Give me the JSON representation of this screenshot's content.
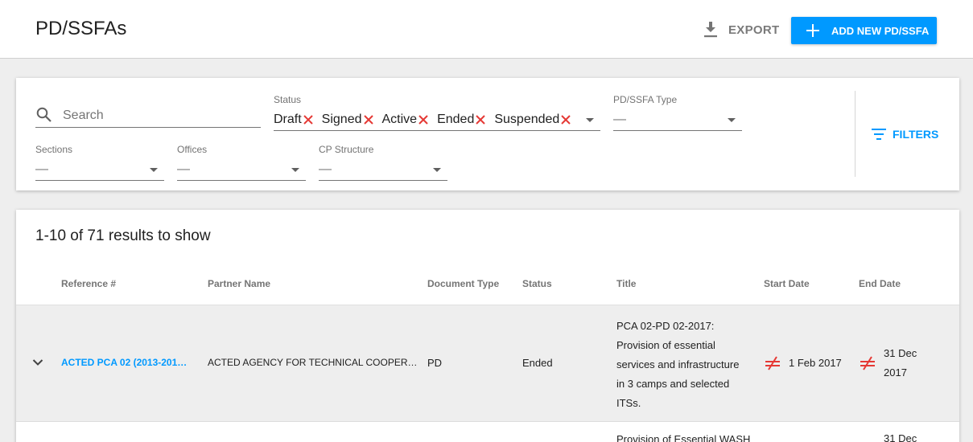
{
  "header": {
    "title": "PD/SSFAs",
    "export_label": "EXPORT",
    "add_label": "ADD NEW PD/SSFA"
  },
  "filters": {
    "search_placeholder": "Search",
    "status": {
      "label": "Status",
      "chips": [
        "Draft",
        "Signed",
        "Active",
        "Ended",
        "Suspended"
      ]
    },
    "type": {
      "label": "PD/SSFA Type",
      "value": "—"
    },
    "sections": {
      "label": "Sections",
      "value": "—"
    },
    "offices": {
      "label": "Offices",
      "value": "—"
    },
    "cp_structure": {
      "label": "CP Structure",
      "value": "—"
    },
    "filters_label": "FILTERS"
  },
  "results": {
    "count_text": "1-10 of 71 results to show",
    "columns": [
      "Reference #",
      "Partner Name",
      "Document Type",
      "Status",
      "Title",
      "Start Date",
      "End Date"
    ],
    "rows": [
      {
        "reference": "ACTED PCA 02 (2013-201…",
        "partner": "ACTED AGENCY FOR TECHNICAL COOPER…",
        "doc_type": "PD",
        "status": "Ended",
        "title_lines": [
          "PCA 02-PD 02-2017:",
          "Provision of essential",
          "services and infrastructure",
          "in 3 camps and selected",
          "ITSs."
        ],
        "start_date": "1 Feb 2017",
        "end_date_lines": [
          "31 Dec",
          "2017"
        ]
      },
      {
        "title_lines": [
          "Provision of Essential WASH"
        ],
        "end_date_lines": [
          "31 Dec"
        ]
      }
    ]
  },
  "colors": {
    "accent": "#0099ff",
    "chip_remove": "#e53935",
    "row_hover": "#eeeeee"
  }
}
